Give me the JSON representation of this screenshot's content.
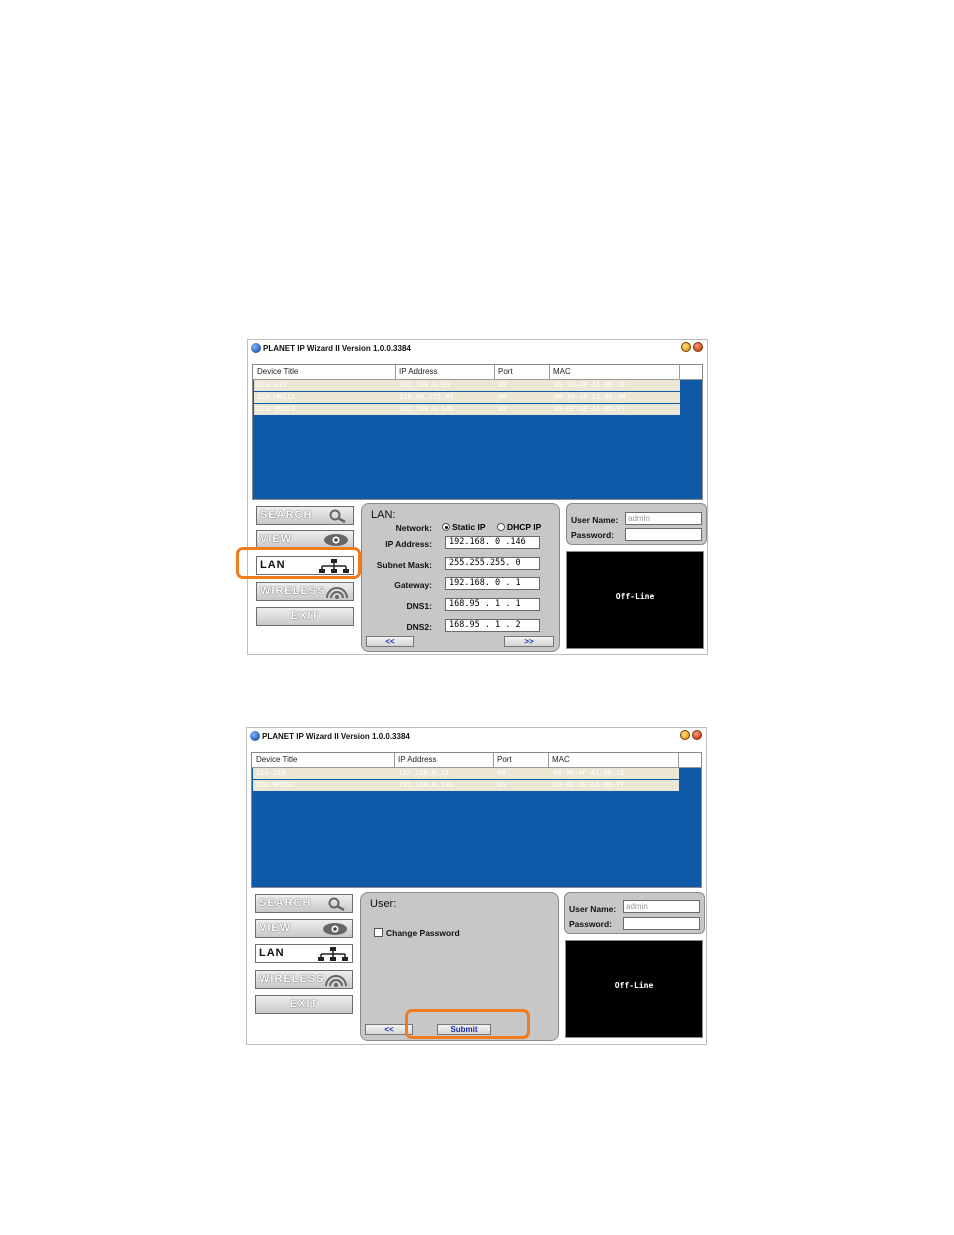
{
  "app_title": "PLANET IP Wizard II  Version 1.0.0.3384",
  "columns": [
    "Device Title",
    "IP Address",
    "Port",
    "MAC"
  ],
  "nav": {
    "search": "SEARCH",
    "view": "VIEW",
    "lan": "LAN",
    "wireless": "WIRELESS",
    "exit": "EXIT"
  },
  "auth": {
    "username_label": "User Name:",
    "username_value": "admin",
    "password_label": "Password:",
    "password_value": ""
  },
  "video_status": "Off-Line",
  "screen1": {
    "devices": [
      {
        "title": "ICA-310",
        "ip": "192.168.0.33",
        "port": "80",
        "mac": "00-30-4F-A1-0B-1E"
      },
      {
        "title": "ICA-HM312",
        "ip": "210.66.155.85",
        "port": "80",
        "mac": "00-30-4F-A1-B6-4B"
      },
      {
        "title": "ICA-HM351",
        "ip": "192.168.0.146",
        "port": "80",
        "mac": "00-0E-AE-A1-B5-FF"
      }
    ],
    "panel": {
      "title": "LAN:",
      "network_label": "Network:",
      "static_ip": "Static IP",
      "dhcp_ip": "DHCP IP",
      "ip_label": "IP Address:",
      "ip_value": "192.168. 0 .146",
      "subnet_label": "Subnet Mask:",
      "subnet_value": "255.255.255. 0",
      "gateway_label": "Gateway:",
      "gateway_value": "192.168. 0 . 1",
      "dns1_label": "DNS1:",
      "dns1_value": "168.95 . 1 . 1",
      "dns2_label": "DNS2:",
      "dns2_value": "168.95 . 1 . 2",
      "prev": "<<",
      "next": ">>"
    }
  },
  "screen2": {
    "devices": [
      {
        "title": "ICA-310",
        "ip": "192.168.0.33",
        "port": "80",
        "mac": "00-30-4F-A1-0B-1E"
      },
      {
        "title": "ICA-HM351",
        "ip": "192.168.0.146",
        "port": "80",
        "mac": "00-0E-AE-A1-B5-FF"
      }
    ],
    "panel": {
      "title": "User:",
      "change_password": "Change Password",
      "prev": "<<",
      "submit": "Submit"
    }
  },
  "colors": {
    "highlight": "#f07c1e",
    "grid_bg": "#0e5aa8",
    "panel_bg": "#c7c7c7",
    "row_bg": "#ece6d4"
  }
}
